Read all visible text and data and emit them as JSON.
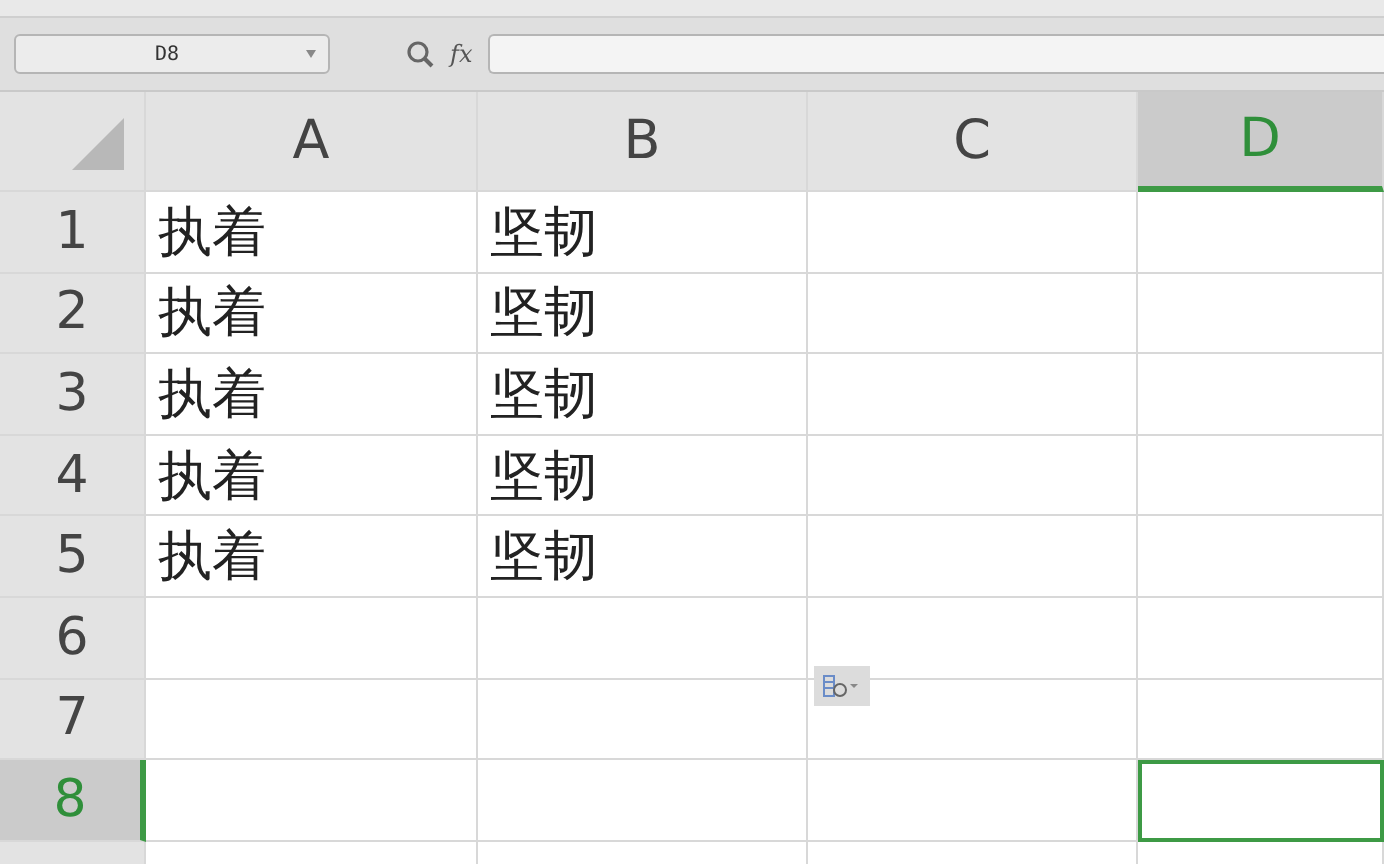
{
  "name_box": {
    "value": "D8"
  },
  "formula_bar": {
    "function_label": "fx"
  },
  "columns": [
    {
      "label": "A",
      "selected": false
    },
    {
      "label": "B",
      "selected": false
    },
    {
      "label": "C",
      "selected": false
    },
    {
      "label": "D",
      "selected": true
    }
  ],
  "rows": [
    {
      "label": "1",
      "selected": false,
      "cells": [
        "执着",
        "坚韧"
      ]
    },
    {
      "label": "2",
      "selected": false,
      "cells": [
        "执着",
        "坚韧"
      ]
    },
    {
      "label": "3",
      "selected": false,
      "cells": [
        "执着",
        "坚韧"
      ]
    },
    {
      "label": "4",
      "selected": false,
      "cells": [
        "执着",
        "坚韧"
      ]
    },
    {
      "label": "5",
      "selected": false,
      "cells": [
        "执着",
        "坚韧"
      ]
    },
    {
      "label": "6",
      "selected": false,
      "paste_options": true
    },
    {
      "label": "7",
      "selected": false
    },
    {
      "label": "8",
      "selected": true
    }
  ]
}
